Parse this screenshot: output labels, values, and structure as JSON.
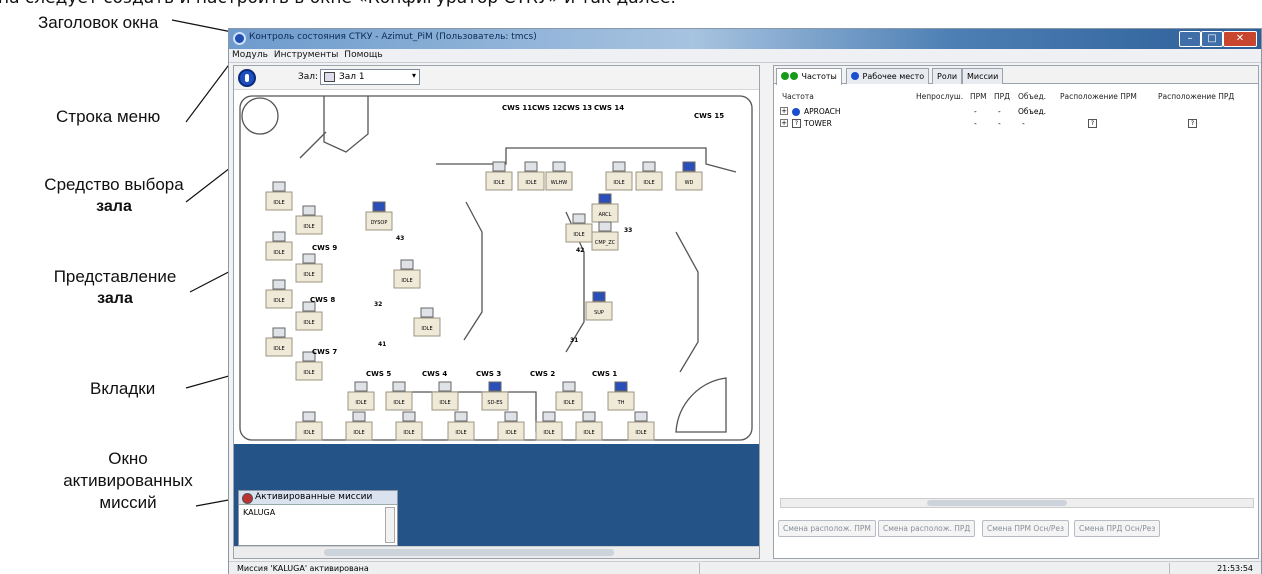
{
  "page": {
    "caption_top": "на следует создать и настроить в окне «Конфигуратор СТКУ» и так далее."
  },
  "annotations": {
    "window_title": "Заголовок окна",
    "menu_bar": "Строка меню",
    "hall_selector_line1": "Средство выбора",
    "hall_selector_line2": "зала",
    "hall_view_line1": "Представление",
    "hall_view_line2": "зала",
    "tabs": "Вкладки",
    "activated_line1": "Окно",
    "activated_line2": "активированных",
    "activated_line3": "миссий"
  },
  "window": {
    "title": "Контроль состояния СТКУ - Azimut_PiM (Пользователь: tmcs)",
    "caption_buttons": {
      "minimize": "–",
      "maximize": "□",
      "close": "✕"
    }
  },
  "menu": {
    "items": [
      "Модуль",
      "Инструменты",
      "Помощь"
    ]
  },
  "hall": {
    "label": "Зал:",
    "selected": "Зал 1",
    "cws_labels": [
      "CWS 11",
      "CWS 12",
      "CWS 13",
      "CWS 14",
      "CWS 15",
      "CWS 9",
      "CWS 8",
      "CWS 7",
      "CWS 5",
      "CWS 4",
      "CWS 3",
      "CWS 2",
      "CWS 1"
    ],
    "position_numbers": [
      "43",
      "42",
      "33",
      "32",
      "31",
      "41"
    ],
    "operator_labels": [
      "DYSOP",
      "ARCL",
      "CMP_ZC",
      "SUP",
      "WLHW",
      "WD",
      "SD-ES",
      "TH"
    ],
    "idle_label": "IDLE"
  },
  "missions_panel": {
    "title": "Активированные миссии",
    "items": [
      "KALUGA"
    ]
  },
  "tabs": [
    {
      "label": "Частоты",
      "icon_colors": [
        "#1a9a1a",
        "#1a9a1a"
      ]
    },
    {
      "label": "Рабочее место",
      "icon_colors": [
        "#1a4fd0"
      ]
    },
    {
      "label": "Роли"
    },
    {
      "label": "Миссии"
    }
  ],
  "grid": {
    "columns": [
      "Частота",
      "Непрослуш.",
      "ПРМ",
      "ПРД",
      "Объед.",
      "Расположение ПРМ",
      "Расположение ПРД"
    ],
    "rows": [
      {
        "expand": "+",
        "icon": "globe",
        "name": "APROACH",
        "nonlisten": "",
        "rx": "-",
        "tx": "-",
        "merged": "Объед.",
        "rx_loc": "",
        "tx_loc": ""
      },
      {
        "expand": "+",
        "icon": "?",
        "name": "TOWER",
        "nonlisten": "",
        "rx": "-",
        "tx": "-",
        "merged": "-",
        "rx_loc": "?",
        "tx_loc": "?"
      }
    ]
  },
  "right_buttons": [
    "Смена располож. ПРМ",
    "Смена располож. ПРД",
    "Смена ПРМ Осн/Рез",
    "Смена ПРД Осн/Рез"
  ],
  "status": {
    "message": "Миссия 'KALUGA' активирована",
    "time": "21:53:54"
  },
  "colors": {
    "dark_pane": "#245487",
    "titlebar": "#4d7fb4",
    "close": "#c8452e"
  }
}
